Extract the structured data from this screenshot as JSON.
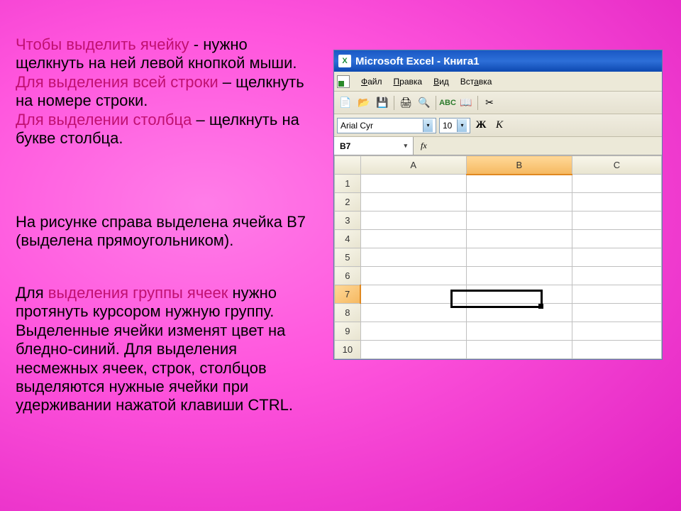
{
  "text": {
    "p1a": "Чтобы выделить ячейку",
    "p1b": "  -  нужно щелкнуть на ней левой кнопкой мыши.",
    "p2a": "Для выделения всей строки",
    "p2b": " – щелкнуть на номере строки.",
    "p3a": "Для выделении столбца",
    "p3b": " – щелкнуть на букве столбца.",
    "p4": "На рисунке справа выделена ячейка В7 (выделена прямоугольником).",
    "p5a": "Для ",
    "p5b": "выделения группы ячеек",
    "p5c": " нужно протянуть курсором нужную группу. Выделенные ячейки изменят цвет на бледно-синий. Для выделения несмежных ячеек, строк, столбцов выделяются нужные ячейки при удерживании нажатой клавиши CTRL."
  },
  "excel": {
    "title": "Microsoft Excel - Книга1",
    "app_icon": "X",
    "menu": {
      "file": "Файл",
      "edit": "Правка",
      "view": "Вид",
      "insert": "Вставка"
    },
    "font_name": "Arial Cyr",
    "font_size": "10",
    "bold": "Ж",
    "italic": "К",
    "namebox": "B7",
    "fx": "fx",
    "columns": [
      "A",
      "B",
      "C"
    ],
    "rows": [
      "1",
      "2",
      "3",
      "4",
      "5",
      "6",
      "7",
      "8",
      "9",
      "10"
    ],
    "active_col": "B",
    "active_row": "7"
  },
  "icons": {
    "new": "📄",
    "open": "📂",
    "save": "💾",
    "print": "🖨",
    "preview": "🔍",
    "spell": "✓",
    "cut": "✂",
    "arrow_down": "▾"
  }
}
